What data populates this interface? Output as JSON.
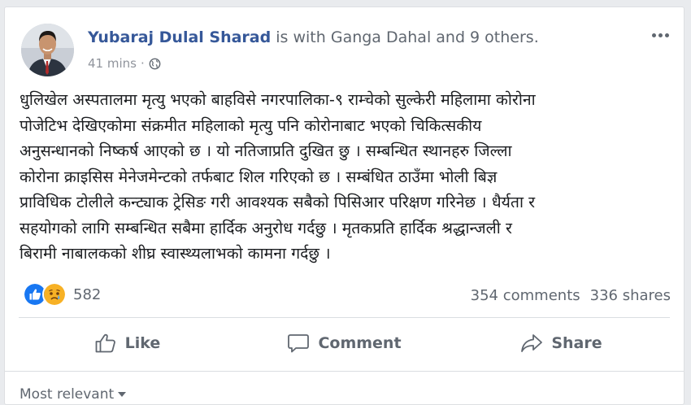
{
  "post": {
    "author": "Yubaraj Dulal Sharad",
    "with_text": " is with Ganga Dahal and 9 others.",
    "time": "41 mins",
    "separator": "·",
    "privacy_icon": "globe-icon",
    "body_lines": [
      "धुलिखेल अस्पतालमा मृत्यु भएको बाहविसे नगरपालिका-९ राम्चेको सुल्केरी महिलामा कोरोना",
      "पोजेटिभ देखिएकोमा संक्रमीत महिलाको मृत्यु पनि कोरोनाबाट भएको चिकित्सकीय",
      "अनुसन्धानको निष्कर्ष आएको छ । यो नतिजाप्रति दुखित छु । सम्बन्धित स्थानहरु जिल्ला",
      "कोरोना क्राइसिस मेनेजमेन्टको तर्फबाट शिल गरिएको छ । सम्बंधित ठाउँमा भोली बिज्ञ",
      "प्राविधिक टोलीले कन्ट्याक ट्रेसिङ गरी आवश्यक सबैको पिसिआर परिक्षण गरिनेछ । धैर्यता र",
      "सहयोगको लागि सम्बन्धित सबैमा हार्दिक अनुरोध गर्दछु । मृतकप्रति हार्दिक श्रद्धान्जली र",
      "बिरामी नाबालकको शीघ्र स्वास्थ्यलाभको कामना गर्दछु ।"
    ]
  },
  "reactions": {
    "count": "582",
    "icons": [
      "like-reaction-icon",
      "sad-reaction-icon"
    ],
    "comments": "354 comments",
    "shares": "336 shares"
  },
  "actions": {
    "like": "Like",
    "comment": "Comment",
    "share": "Share"
  },
  "comments_filter": {
    "label": "Most relevant"
  },
  "colors": {
    "link": "#365899",
    "like_blue": "#1877f2",
    "sad_yellow": "#f7b125",
    "muted": "#606770"
  }
}
